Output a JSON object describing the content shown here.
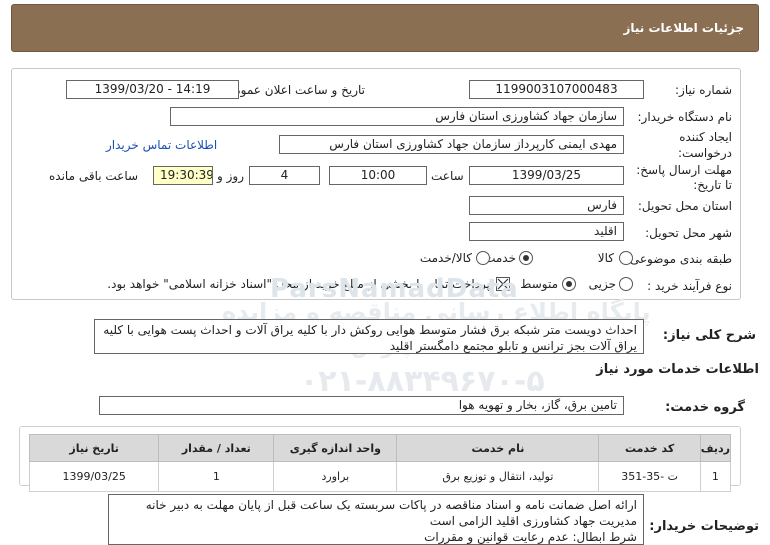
{
  "header": {
    "title": "جزئیات اطلاعات نیاز"
  },
  "form": {
    "need_number_label": "شماره نیاز:",
    "need_number": "1199003107000483",
    "announce_label": "تاریخ و ساعت اعلان عمومی:",
    "announce_value": "1399/03/20 - 14:19",
    "buyer_org_label": "نام دستگاه خریدار:",
    "buyer_org": "سازمان جهاد کشاورزی استان فارس",
    "creator_label_1": "ایجاد کننده",
    "creator_label_2": "درخواست:",
    "creator_value": "مهدی ایمنی کارپرداز سازمان جهاد کشاورزی استان فارس",
    "contact_link": "اطلاعات تماس خریدار",
    "deadline_label_1": "مهلت ارسال پاسخ:",
    "deadline_label_2": "تا تاریخ:",
    "deadline_date": "1399/03/25",
    "time_label": "ساعت",
    "deadline_time": "10:00",
    "days_value": "4",
    "days_label": "روز و",
    "remaining_value": "19:30:39",
    "remaining_label": "ساعت باقی مانده",
    "province_label": "استان محل تحویل:",
    "province": "فارس",
    "city_label": "شهر محل تحویل:",
    "city": "اقلید",
    "category_label": "طبقه بندی موضوعی:",
    "category_options": [
      "کالا",
      "خدمت",
      "کالا/خدمت"
    ],
    "category_selected": "خدمت",
    "process_label": "نوع فرآیند خرید :",
    "process_options": [
      "جزیی",
      "متوسط"
    ],
    "process_selected": "متوسط",
    "payment_note": "پرداخت تمام یا بخشی از مبلغ خرید،از محل \"اسناد خزانه اسلامی\" خواهد بود.",
    "payment_checked": true
  },
  "summary": {
    "label": "شرح کلی نیاز:",
    "text": "احداث دویست متر شبکه برق فشار متوسط هوایی روکش دار با کلیه یراق آلات و احداث پست هوایی با کلیه یراق آلات بجز ترانس و تابلو  مجتمع دامگستر اقلید"
  },
  "services": {
    "section_title": "اطلاعات خدمات مورد نیاز",
    "group_label": "گروه خدمت:",
    "group_value": "تامین برق، گاز، بخار و تهویه هوا",
    "columns": [
      "ردیف",
      "کد خدمت",
      "نام خدمت",
      "واحد اندازه گیری",
      "تعداد / مقدار",
      "تاریخ نیاز"
    ],
    "rows": [
      [
        "1",
        "ت -35-351",
        "تولید، انتقال و توزیع برق",
        "براورد",
        "1",
        "1399/03/25"
      ]
    ]
  },
  "buyer_notes": {
    "label": "توضیحات خریدار:",
    "lines": [
      "ارائه اصل ضمانت نامه و اسناد مناقصه  در پاکات سربسته یک ساعت قبل از پایان مهلت به دبیر خانه",
      "مدیریت جهاد کشاورزی اقلید الزامی است",
      "شرط ابطال: عدم رعایت قوانین و مقررات"
    ]
  },
  "watermark": {
    "line1": "ParsNamadData",
    "line2": "پایگاه اطلاع رسانی مناقصه و مزایده",
    "line3": "پارس نماد داده",
    "line4": "۰۲۱-۸۸۳۴۹۶۷۰-۵"
  }
}
